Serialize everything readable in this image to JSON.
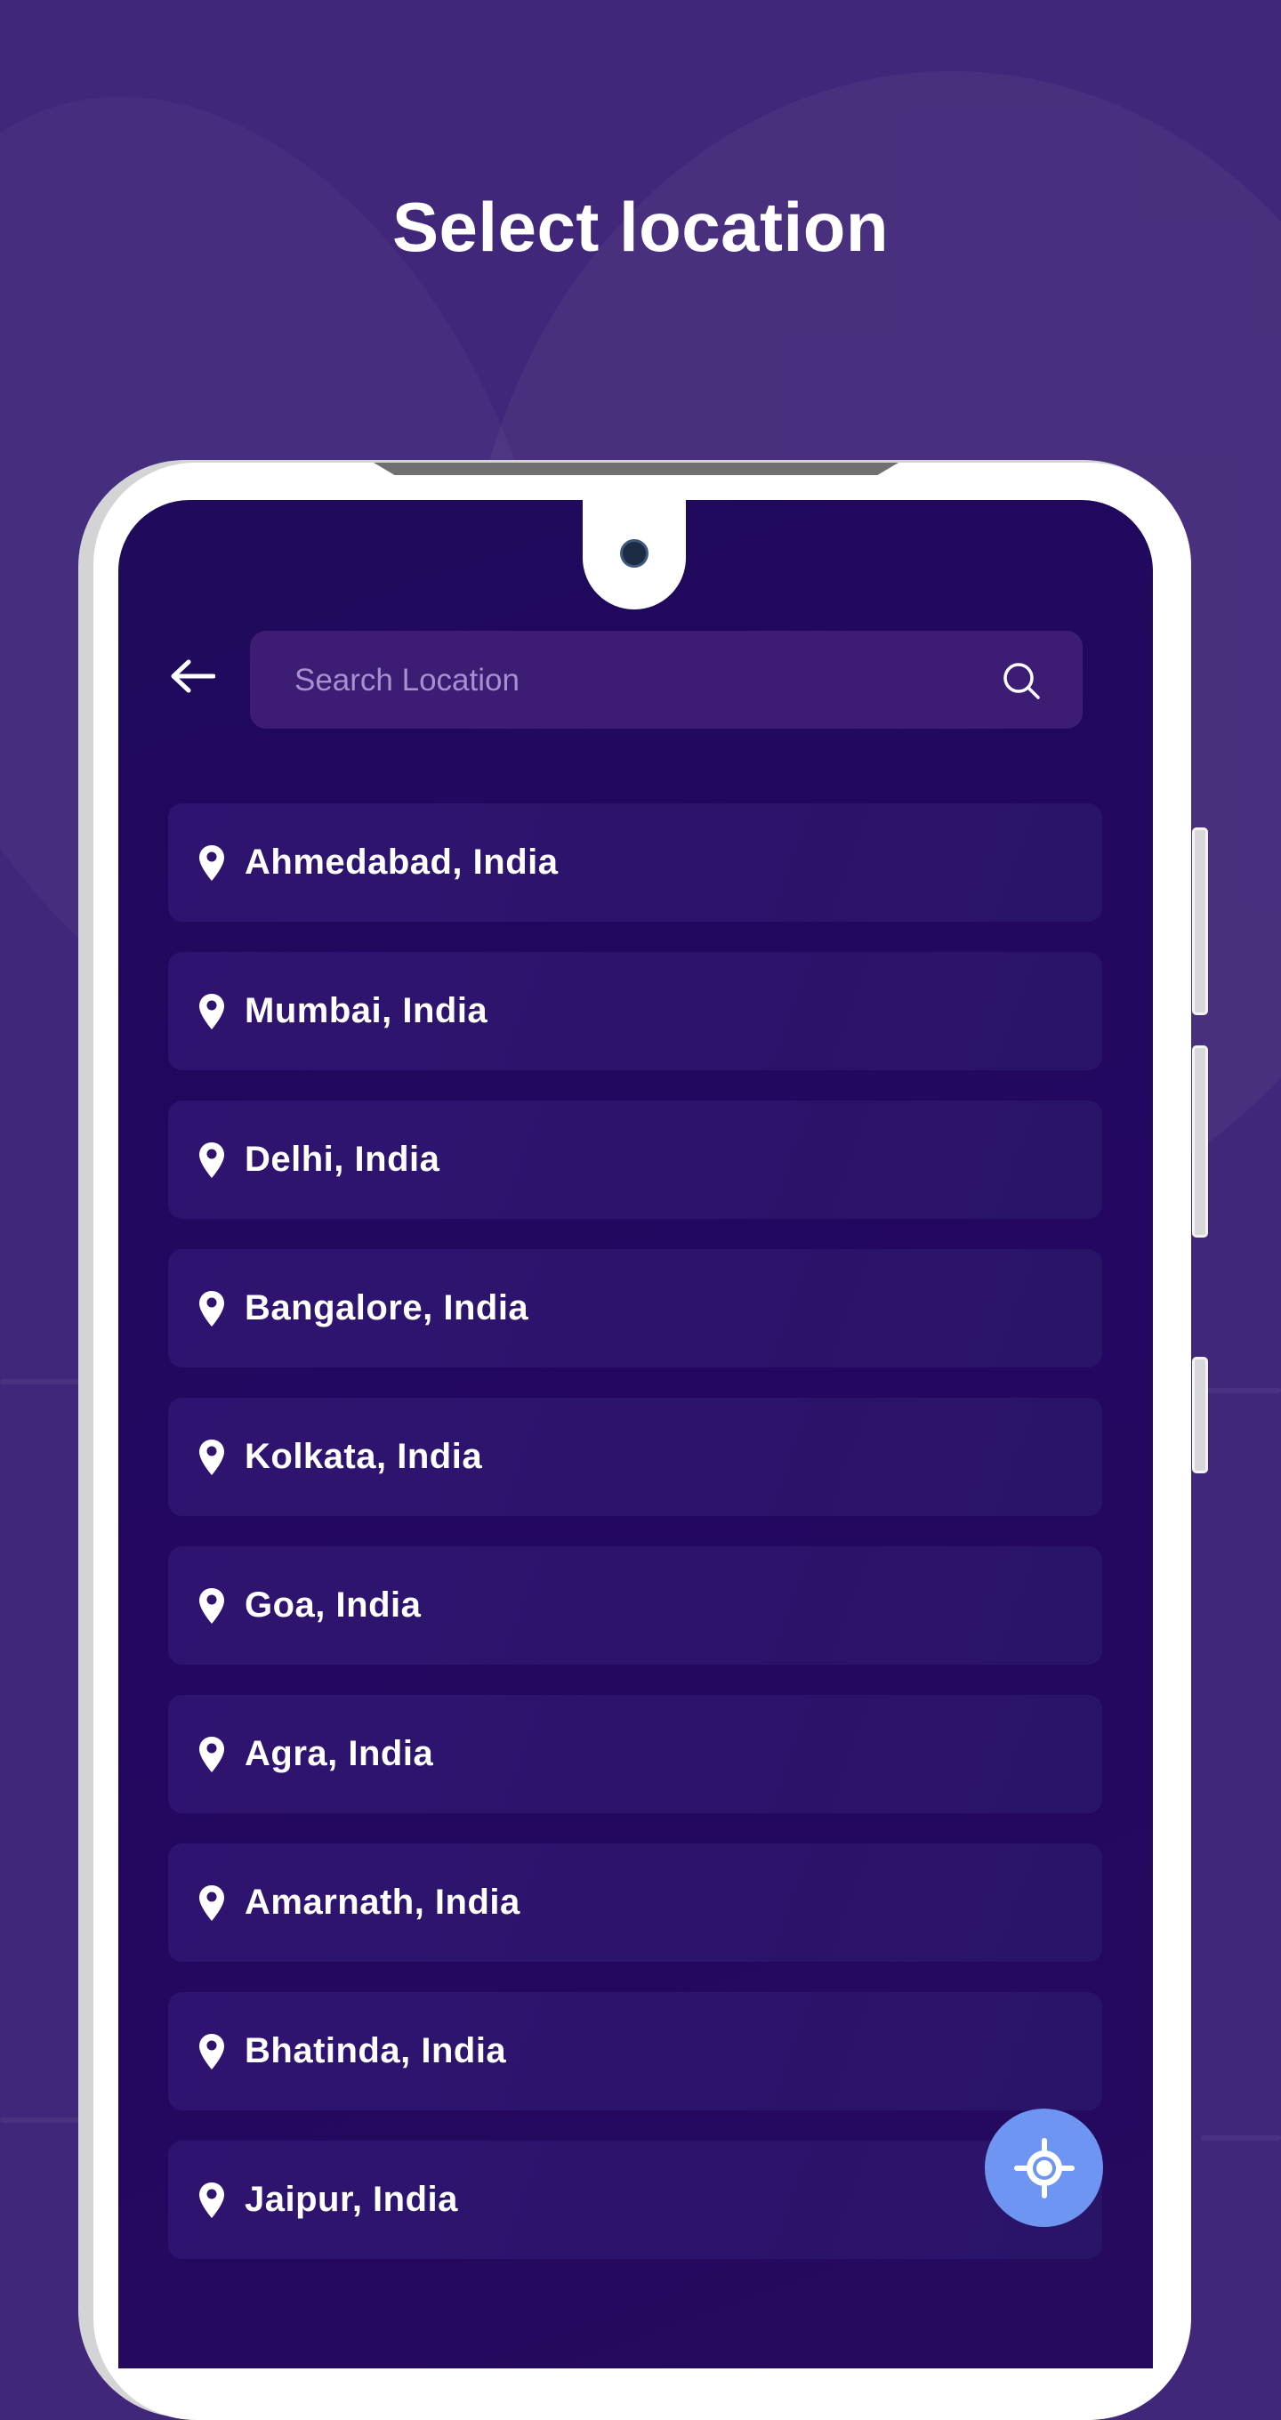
{
  "header": {
    "title": "Select location"
  },
  "search": {
    "placeholder": "Search Location",
    "value": "",
    "back_icon": "arrow-left-icon",
    "search_icon": "search-icon"
  },
  "locations": [
    {
      "label": "Ahmedabad, India"
    },
    {
      "label": "Mumbai, India"
    },
    {
      "label": "Delhi, India"
    },
    {
      "label": "Bangalore, India"
    },
    {
      "label": "Kolkata, India"
    },
    {
      "label": "Goa, India"
    },
    {
      "label": "Agra, India"
    },
    {
      "label": "Amarnath, India"
    },
    {
      "label": "Bhatinda, India"
    },
    {
      "label": "Jaipur, India"
    }
  ],
  "fab": {
    "icon": "gps-crosshair-icon"
  },
  "colors": {
    "background": "#40277a",
    "screen": "#230760",
    "item": "#2e1470",
    "search_box": "#3d1d74",
    "fab": "#6e95f2",
    "placeholder": "#a88fcf"
  }
}
